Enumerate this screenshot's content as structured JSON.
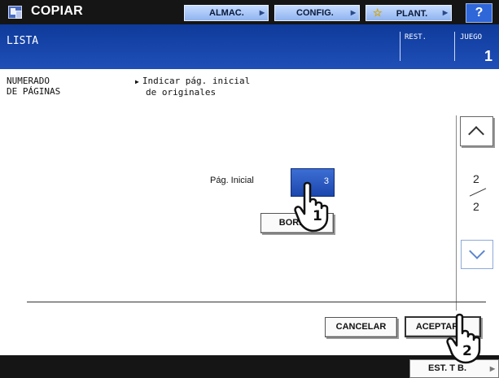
{
  "topbar": {
    "title": "COPIAR",
    "app_icon": "copier-icon",
    "buttons": {
      "almac": "ALMAC.",
      "config": "CONFIG.",
      "plant": "PLANT.",
      "help": "?"
    }
  },
  "header": {
    "title": "LISTA",
    "rest_label": "REST.",
    "juego_label": "JUEGO",
    "juego_value": "1"
  },
  "setting": {
    "name_line1": "NUMERADO",
    "name_line2": "DE PÁGINAS",
    "instruction_line1": "Indicar pág. inicial",
    "instruction_line2": "de originales"
  },
  "page_field": {
    "label": "Pág. Inicial",
    "value": "3"
  },
  "buttons": {
    "borrar": "BORR",
    "cancelar": "CANCELAR",
    "aceptar": "ACEPTAR",
    "est_trab": "EST. T B."
  },
  "pagination": {
    "current": "2",
    "total": "2"
  },
  "markers": {
    "step1": "1",
    "step2": "2"
  },
  "colors": {
    "header_blue": "#1f4fb8",
    "field_blue": "#1b47ad",
    "topbar_black": "#151515"
  }
}
